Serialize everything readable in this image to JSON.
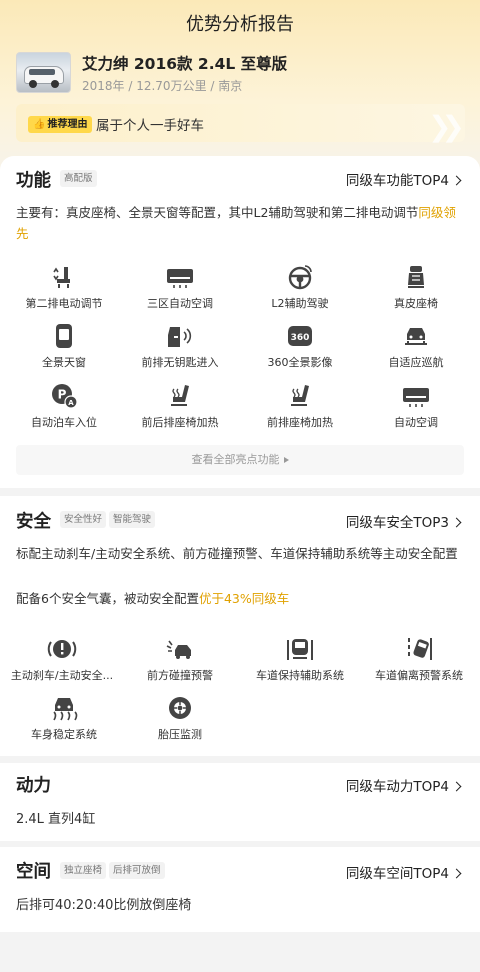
{
  "page_title": "优势分析报告",
  "car": {
    "name": "艾力绅 2016款 2.4L 至尊版",
    "meta": "2018年 / 12.70万公里 / 南京"
  },
  "reason": {
    "tag": "推荐理由",
    "text": "属于个人一手好车"
  },
  "function": {
    "title": "功能",
    "badge": "高配版",
    "rank": "同级车功能TOP4",
    "summary_prefix": "主要有：真皮座椅、全景天窗等配置，其中L2辅助驾驶和第二排电动调节",
    "summary_highlight": "同级领先",
    "features": [
      {
        "label": "第二排电动调节",
        "icon": "seat-adjust-icon"
      },
      {
        "label": "三区自动空调",
        "icon": "air-conditioner-icon"
      },
      {
        "label": "L2辅助驾驶",
        "icon": "steering-wheel-icon"
      },
      {
        "label": "真皮座椅",
        "icon": "leather-seat-icon"
      },
      {
        "label": "全景天窗",
        "icon": "sunroof-icon"
      },
      {
        "label": "前排无钥匙进入",
        "icon": "keyless-entry-icon"
      },
      {
        "label": "360全景影像",
        "icon": "camera-360-icon"
      },
      {
        "label": "自适应巡航",
        "icon": "adaptive-cruise-icon"
      },
      {
        "label": "自动泊车入位",
        "icon": "auto-parking-icon"
      },
      {
        "label": "前后排座椅加热",
        "icon": "seat-heating-icon"
      },
      {
        "label": "前排座椅加热",
        "icon": "front-seat-heating-icon"
      },
      {
        "label": "自动空调",
        "icon": "auto-ac-icon"
      }
    ],
    "view_all": "查看全部亮点功能"
  },
  "safety": {
    "title": "安全",
    "badges": [
      "安全性好",
      "智能驾驶"
    ],
    "rank": "同级车安全TOP3",
    "para1": "标配主动刹车/主动安全系统、前方碰撞预警、车道保持辅助系统等主动安全配置",
    "para2_prefix": "配备6个安全气囊，被动安全配置",
    "para2_highlight": "优于43%同级车",
    "features": [
      {
        "label": "主动刹车/主动安全...",
        "icon": "brake-warning-icon"
      },
      {
        "label": "前方碰撞预警",
        "icon": "collision-warning-icon"
      },
      {
        "label": "车道保持辅助系统",
        "icon": "lane-keep-icon"
      },
      {
        "label": "车道偏离预警系统",
        "icon": "lane-departure-icon"
      },
      {
        "label": "车身稳定系统",
        "icon": "stability-control-icon"
      },
      {
        "label": "胎压监测",
        "icon": "tire-pressure-icon"
      }
    ]
  },
  "power": {
    "title": "动力",
    "rank": "同级车动力TOP4",
    "text": "2.4L 直列4缸"
  },
  "space": {
    "title": "空间",
    "badges": [
      "独立座椅",
      "后排可放倒"
    ],
    "rank": "同级车空间TOP4",
    "text": "后排可40:20:40比例放倒座椅"
  },
  "colors": {
    "highlight": "#e0a100",
    "tag_bg": "#ffd84a",
    "hero_bg": "#fbe9b8"
  }
}
